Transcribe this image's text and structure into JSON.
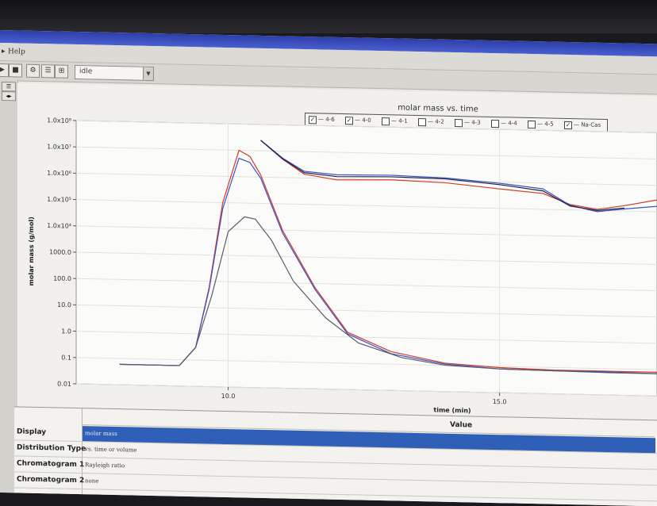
{
  "menubar": {
    "help": "Help"
  },
  "toolbar": {
    "status_value": "idle"
  },
  "chart_data": {
    "type": "line",
    "title": "molar mass vs. time",
    "xlabel": "time (min)",
    "ylabel": "molar mass (g/mol)",
    "log_y": true,
    "xlim": [
      7.2,
      17.9
    ],
    "ylim": [
      0.01,
      100000000
    ],
    "x_ticks": [
      10.0,
      15.0
    ],
    "x_tick_labels": [
      "10.0",
      "15.0"
    ],
    "y_ticks": [
      0.01,
      0.1,
      1,
      10,
      100,
      1000,
      10000,
      100000,
      1000000,
      10000000,
      100000000
    ],
    "y_tick_labels": [
      "0.01",
      "0.1",
      "1.0",
      "10.0",
      "100.0",
      "1000.0",
      "1.0x10⁴",
      "1.0x10⁵",
      "1.0x10⁶",
      "1.0x10⁷",
      "1.0x10⁸"
    ],
    "grid": true,
    "legend_position": "top",
    "legend": [
      {
        "label": "— 4-6",
        "checked": true
      },
      {
        "label": "— 4-0",
        "checked": true
      },
      {
        "label": "— 4-1",
        "checked": false
      },
      {
        "label": "— 4-2",
        "checked": false
      },
      {
        "label": "— 4-3",
        "checked": false
      },
      {
        "label": "— 4-4",
        "checked": false
      },
      {
        "label": "— 4-5",
        "checked": false
      },
      {
        "label": "— Na-Cas",
        "checked": true
      }
    ],
    "series": [
      {
        "kind": "signal",
        "color": "#d03b2a",
        "x": [
          8.0,
          9.1,
          9.4,
          9.65,
          9.9,
          10.2,
          10.4,
          10.6,
          11.0,
          11.6,
          12.2,
          13.0,
          14.0,
          15.0,
          16.0,
          17.0,
          17.9
        ],
        "y": [
          0.06,
          0.06,
          0.3,
          60,
          100000,
          10000000,
          6000000,
          1200000,
          10000,
          70,
          1.5,
          0.3,
          0.12,
          0.09,
          0.08,
          0.08,
          0.08
        ]
      },
      {
        "kind": "signal",
        "color": "#3d52c8",
        "x": [
          8.0,
          9.1,
          9.4,
          9.65,
          9.9,
          10.2,
          10.4,
          10.6,
          11.0,
          11.6,
          12.2,
          13.0,
          14.0,
          15.0,
          16.0,
          17.0,
          17.9
        ],
        "y": [
          0.06,
          0.06,
          0.3,
          50,
          60000,
          5000000,
          3500000,
          900000,
          8000,
          60,
          1.3,
          0.25,
          0.11,
          0.08,
          0.075,
          0.075,
          0.07
        ]
      },
      {
        "kind": "signal",
        "color": "#5a5a6a",
        "x": [
          8.0,
          9.1,
          9.4,
          9.7,
          10.0,
          10.3,
          10.5,
          10.8,
          11.2,
          11.8,
          12.4,
          13.2,
          14.0,
          15.0,
          16.0,
          17.0,
          17.9
        ],
        "y": [
          0.06,
          0.06,
          0.3,
          30,
          8000,
          30000,
          25000,
          4000,
          120,
          5,
          0.6,
          0.18,
          0.1,
          0.08,
          0.075,
          0.07,
          0.07
        ]
      },
      {
        "kind": "molar_mass",
        "color": "#d03b2a",
        "x": [
          10.6,
          11.0,
          11.4,
          12.0,
          13.0,
          14.0,
          15.0,
          15.8,
          16.3,
          16.8,
          17.3,
          17.9
        ],
        "y": [
          25000000,
          5000000,
          1400000,
          900000,
          1000000,
          850000,
          550000,
          400000,
          160000,
          110000,
          160000,
          280000
        ]
      },
      {
        "kind": "molar_mass",
        "color": "#3d52c8",
        "x": [
          10.6,
          11.0,
          11.4,
          12.0,
          13.0,
          14.0,
          15.0,
          15.8,
          16.3,
          16.8,
          17.3,
          17.9
        ],
        "y": [
          25000000,
          5500000,
          1800000,
          1400000,
          1500000,
          1300000,
          900000,
          600000,
          150000,
          90000,
          120000,
          160000
        ]
      },
      {
        "kind": "molar_mass",
        "color": "#222244",
        "x": [
          10.6,
          11.0,
          11.4,
          12.0,
          13.0,
          14.0,
          15.0,
          15.8,
          16.3,
          16.8,
          17.3
        ],
        "y": [
          25000000,
          5200000,
          1600000,
          1200000,
          1300000,
          1200000,
          800000,
          500000,
          140000,
          100000,
          130000
        ]
      }
    ]
  },
  "table": {
    "header_value": "Value",
    "rows": [
      {
        "label": "Display",
        "value": "molar mass",
        "selected": true
      },
      {
        "label": "Distribution Type",
        "value": "vs. time or volume",
        "selected": false
      },
      {
        "label": "Chromatogram 1",
        "value": "Rayleigh ratio",
        "selected": false
      },
      {
        "label": "Chromatogram 2",
        "value": "none",
        "selected": false
      }
    ]
  }
}
